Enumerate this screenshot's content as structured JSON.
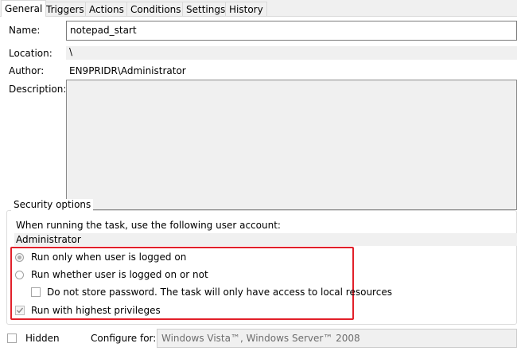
{
  "tabs": [
    {
      "label": "General",
      "active": true
    },
    {
      "label": "Triggers",
      "active": false
    },
    {
      "label": "Actions",
      "active": false
    },
    {
      "label": "Conditions",
      "active": false
    },
    {
      "label": "Settings",
      "active": false
    },
    {
      "label": "History",
      "active": false
    }
  ],
  "general": {
    "name_label": "Name:",
    "name_value": "notepad_start",
    "location_label": "Location:",
    "location_value": "\\",
    "author_label": "Author:",
    "author_value": "EN9PRIDR\\Administrator",
    "description_label": "Description:",
    "description_value": ""
  },
  "security": {
    "group_label": "Security options",
    "account_prompt": "When running the task, use the following user account:",
    "account_value": "Administrator",
    "options": {
      "logged_on_only": {
        "label": "Run only when user is logged on",
        "selected": true
      },
      "logged_on_or_not": {
        "label": "Run whether user is logged on or not",
        "selected": false
      },
      "no_store_password": {
        "label": "Do not store password.  The task will only have access to local resources",
        "checked": false
      },
      "highest_privileges": {
        "label": "Run with highest privileges",
        "checked": true
      }
    }
  },
  "footer": {
    "hidden_label": "Hidden",
    "hidden_checked": false,
    "configure_label": "Configure for:",
    "configure_value": "Windows Vista™, Windows Server™ 2008"
  },
  "colors": {
    "highlight": "#e2202a"
  }
}
